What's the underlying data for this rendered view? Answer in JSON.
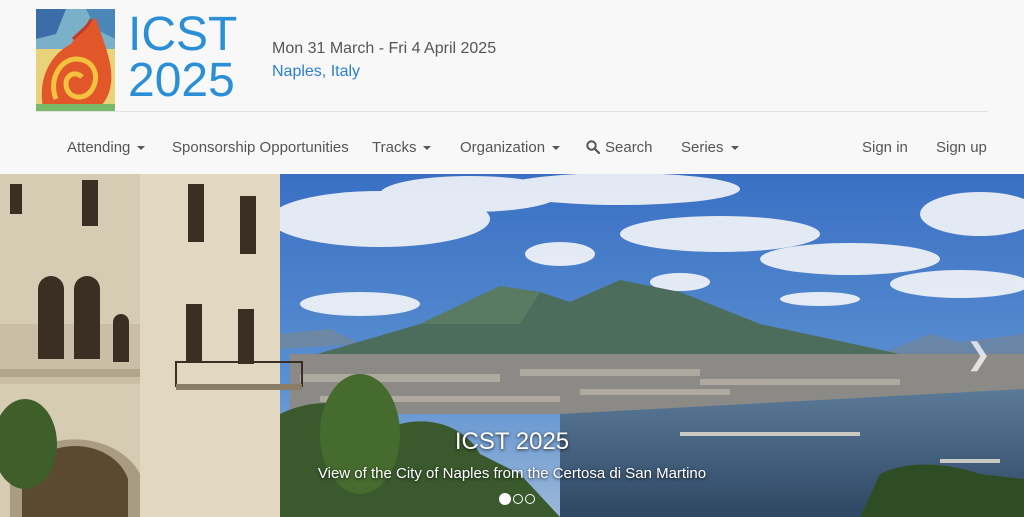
{
  "header": {
    "title_line1": "ICST",
    "title_line2": "2025",
    "dates": "Mon 31 March - Fri 4 April 2025",
    "location": "Naples, Italy"
  },
  "nav": {
    "items": [
      {
        "label": "Attending",
        "dropdown": true
      },
      {
        "label": "Sponsorship Opportunities",
        "dropdown": false
      },
      {
        "label": "Tracks",
        "dropdown": true
      },
      {
        "label": "Organization",
        "dropdown": true
      },
      {
        "label": "Search",
        "dropdown": false,
        "icon": "search-icon"
      },
      {
        "label": "Series",
        "dropdown": true
      }
    ],
    "sign_in": "Sign in",
    "sign_up": "Sign up"
  },
  "carousel": {
    "caption_title": "ICST 2025",
    "caption_text": "View of the City of Naples from the Certosa di San Martino",
    "slide_count": 3,
    "active_slide": 1,
    "next_icon": "chevron-right-icon"
  },
  "colors": {
    "accent": "#2a8fd6",
    "nav_text": "#555555",
    "background": "#f8f8f8"
  }
}
